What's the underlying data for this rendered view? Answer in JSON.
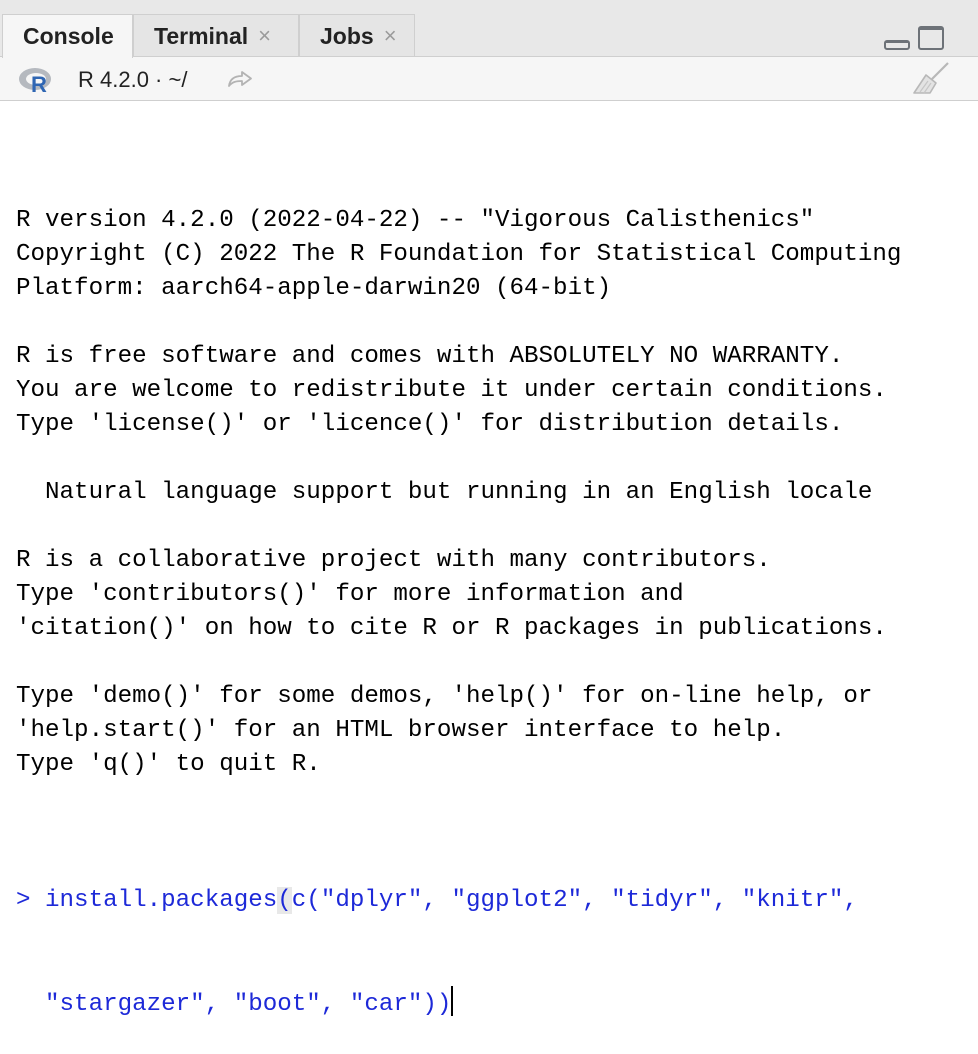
{
  "tabs": [
    {
      "label": "Console",
      "active": true,
      "closable": false
    },
    {
      "label": "Terminal",
      "active": false,
      "closable": true,
      "close_glyph": "×"
    },
    {
      "label": "Jobs",
      "active": false,
      "closable": true,
      "close_glyph": "×"
    }
  ],
  "toolbar": {
    "r_version": "R 4.2.0 · ~/",
    "icons": [
      "r-logo-icon",
      "go-to-directory-icon",
      "clear-console-broom-icon"
    ]
  },
  "console": {
    "startup_lines": [
      "R version 4.2.0 (2022-04-22) -- \"Vigorous Calisthenics\"",
      "Copyright (C) 2022 The R Foundation for Statistical Computing",
      "Platform: aarch64-apple-darwin20 (64-bit)",
      "",
      "R is free software and comes with ABSOLUTELY NO WARRANTY.",
      "You are welcome to redistribute it under certain conditions.",
      "Type 'license()' or 'licence()' for distribution details.",
      "",
      "  Natural language support but running in an English locale",
      "",
      "R is a collaborative project with many contributors.",
      "Type 'contributors()' for more information and",
      "'citation()' on how to cite R or R packages in publications.",
      "",
      "Type 'demo()' for some demos, 'help()' for on-line help, or",
      "'help.start()' for an HTML browser interface to help.",
      "Type 'q()' to quit R.",
      ""
    ],
    "prompt": "> ",
    "input_line1_a": "install.packages",
    "input_line1_paren": "(",
    "input_line1_b": "c(\"dplyr\", \"ggplot2\", \"tidyr\", \"knitr\",",
    "input_line2": "  \"stargazer\", \"boot\", \"car\"))"
  },
  "colors": {
    "command_text": "#1d29d8",
    "tab_bar": "#e8e8e8",
    "active_tab": "#f6f6f6"
  }
}
